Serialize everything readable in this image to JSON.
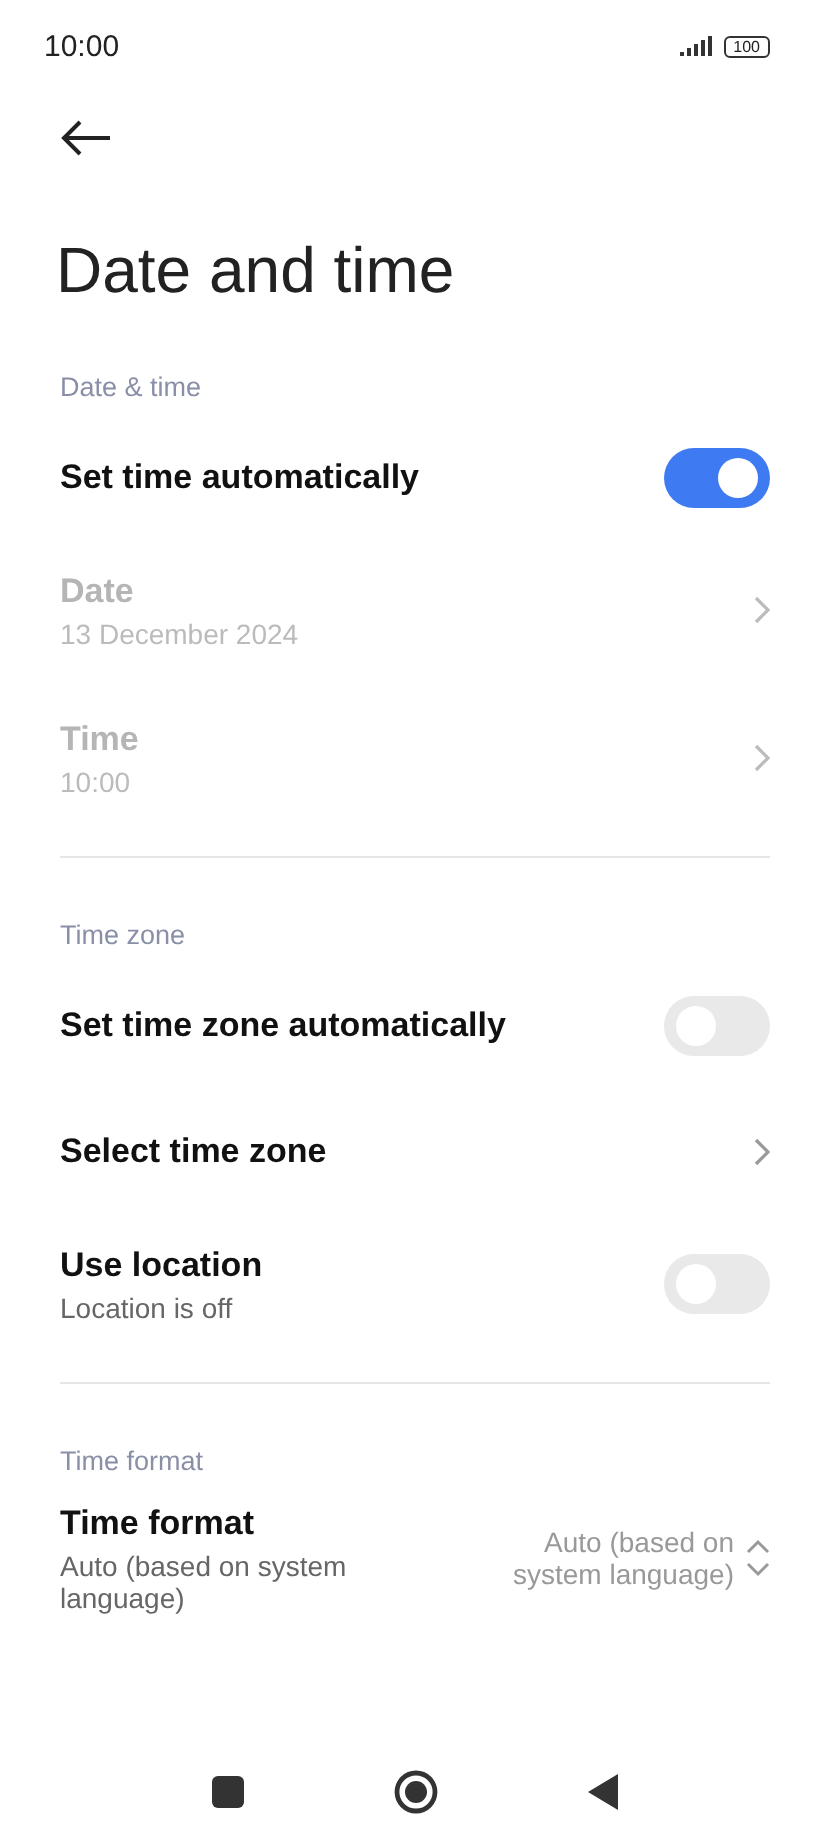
{
  "status_bar": {
    "time": "10:00",
    "battery": "100"
  },
  "title": "Date and time",
  "sections": [
    {
      "header": "Date & time",
      "items": [
        {
          "kind": "toggle",
          "label": "Set time automatically",
          "on": true,
          "disabled": false
        },
        {
          "kind": "link",
          "label": "Date",
          "value": "13 December 2024",
          "disabled": true
        },
        {
          "kind": "link",
          "label": "Time",
          "value": "10:00",
          "disabled": true
        }
      ]
    },
    {
      "header": "Time zone",
      "items": [
        {
          "kind": "toggle",
          "label": "Set time zone automatically",
          "on": false,
          "disabled": false
        },
        {
          "kind": "link",
          "label": "Select time zone",
          "disabled": false
        },
        {
          "kind": "toggle",
          "label": "Use location",
          "value": "Location is off",
          "on": false,
          "disabled": false
        }
      ]
    },
    {
      "header": "Time format",
      "items": [
        {
          "kind": "select",
          "label": "Time format",
          "value": "Auto (based on system language)",
          "choice": "Auto (based on system language)",
          "disabled": false
        }
      ]
    }
  ]
}
